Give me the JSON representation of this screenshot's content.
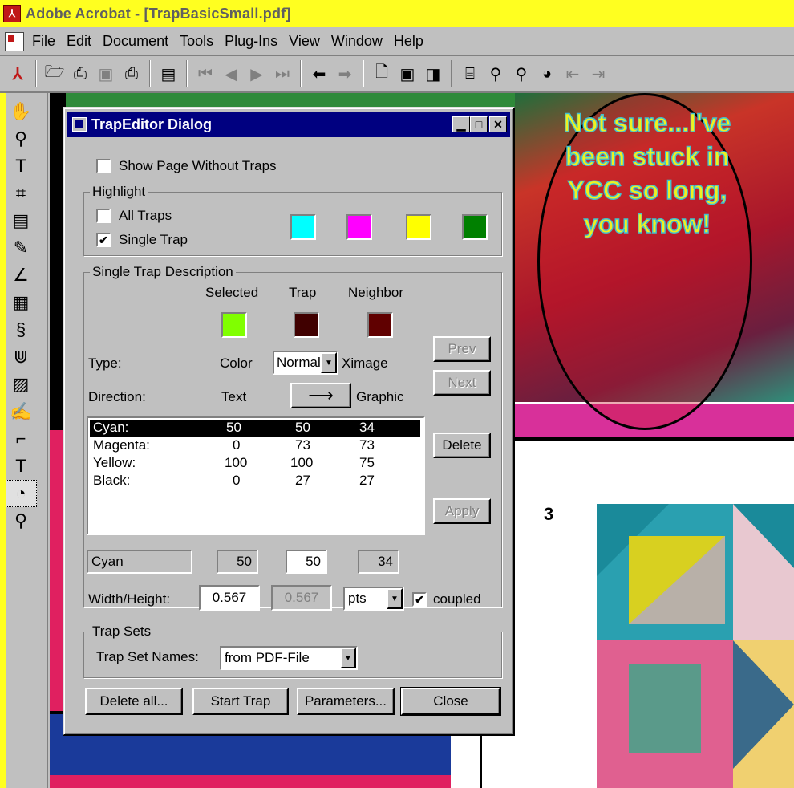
{
  "window": {
    "title": "Adobe Acrobat - [TrapBasicSmall.pdf]"
  },
  "menu": {
    "items": [
      "File",
      "Edit",
      "Document",
      "Tools",
      "Plug-Ins",
      "View",
      "Window",
      "Help"
    ],
    "underlines": [
      "F",
      "E",
      "D",
      "T",
      "P",
      "V",
      "W",
      "H"
    ]
  },
  "toolbar": {
    "icons": [
      "open-icon",
      "print-setup-icon",
      "save-icon",
      "print-icon",
      "show-hide-navigation-icon",
      "first-page-icon",
      "previous-page-icon",
      "next-page-icon",
      "last-page-icon",
      "go-back-icon",
      "go-forward-icon",
      "actual-size-icon",
      "fit-page-icon",
      "fit-width-icon",
      "find-icon",
      "search-icon",
      "search-results-icon",
      "search-previous-icon",
      "search-next-icon"
    ]
  },
  "document": {
    "bubble_text": "Not sure...I've been stuck in YCC so long, you know!",
    "panel_number": "3"
  },
  "dialog": {
    "title": "TrapEditor Dialog",
    "show_page_without_traps": {
      "label": "Show Page Without Traps",
      "checked": false
    },
    "highlight": {
      "label": "Highlight",
      "all_traps": {
        "label": "All Traps",
        "checked": false
      },
      "single_trap": {
        "label": "Single Trap",
        "checked": true
      },
      "colors": [
        "#00FFFF",
        "#FF00FF",
        "#FFFF00",
        "#008000"
      ]
    },
    "single_trap_description": {
      "label": "Single Trap Description",
      "col_selected": "Selected",
      "col_trap": "Trap",
      "col_neighbor": "Neighbor",
      "swatches": {
        "selected": "#80FF00",
        "trap": "#400000",
        "neighbor": "#600000"
      },
      "type_label": "Type:",
      "type_left": "Color",
      "type_value": "Normal",
      "type_right": "Ximage",
      "direction_label": "Direction:",
      "direction_left": "Text",
      "direction_arrow": "⟶",
      "direction_right": "Graphic",
      "prev": "Prev",
      "next": "Next",
      "delete": "Delete",
      "apply": "Apply",
      "rows": [
        {
          "name": "Cyan:",
          "selected": "50",
          "trap": "50",
          "neighbor": "34"
        },
        {
          "name": "Magenta:",
          "selected": "0",
          "trap": "73",
          "neighbor": "73"
        },
        {
          "name": "Yellow:",
          "selected": "100",
          "trap": "100",
          "neighbor": "75"
        },
        {
          "name": "Black:",
          "selected": "0",
          "trap": "27",
          "neighbor": "27"
        }
      ],
      "edit": {
        "name": "Cyan",
        "selected": "50",
        "trap": "50",
        "neighbor": "34"
      },
      "width_height_label": "Width/Height:",
      "width": "0.567",
      "height": "0.567",
      "unit": "pts",
      "coupled": {
        "label": "coupled",
        "checked": true
      }
    },
    "trap_sets": {
      "label": "Trap Sets",
      "names_label": "Trap Set Names:",
      "names_value": "from PDF-File"
    },
    "buttons": {
      "delete_all": "Delete all...",
      "start_trap": "Start Trap",
      "parameters": "Parameters...",
      "close": "Close"
    }
  }
}
